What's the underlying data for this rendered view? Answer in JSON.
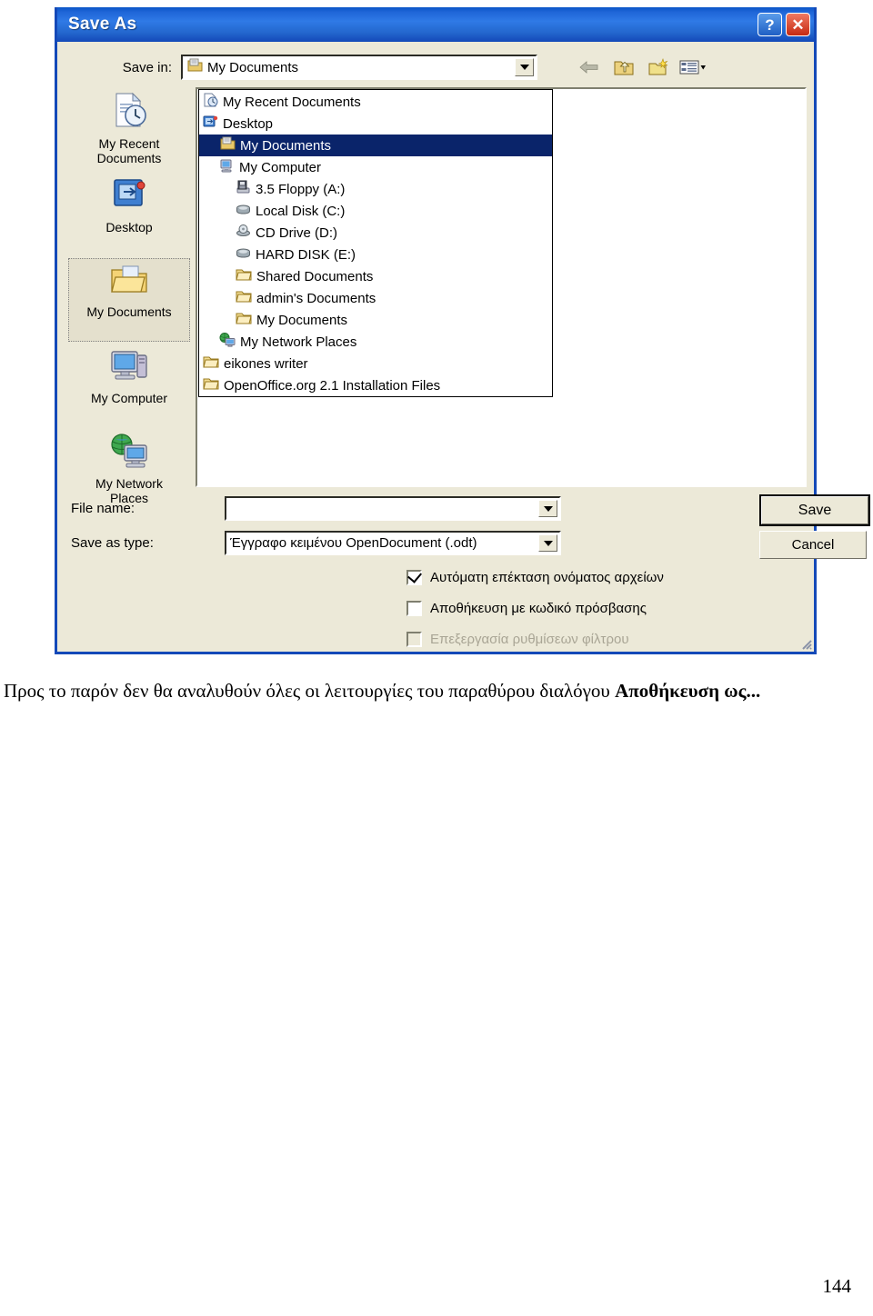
{
  "dialog": {
    "title": "Save As",
    "help_button": "?",
    "close_button": "✕",
    "save_in_label": "Save in:",
    "save_in_value": "My Documents",
    "file_name_label": "File name:",
    "file_name_value": "",
    "file_name_placeholder": "",
    "save_as_type_label": "Save as type:",
    "save_as_type_value": "Έγγραφο κειμένου OpenDocument (.odt)",
    "save_button": "Save",
    "cancel_button": "Cancel",
    "toolbar": [
      {
        "name": "back-icon",
        "tooltip": "Back"
      },
      {
        "name": "up-one-level-icon",
        "tooltip": "Up One Level"
      },
      {
        "name": "create-new-folder-icon",
        "tooltip": "Create New Folder"
      },
      {
        "name": "views-icon",
        "tooltip": "Views"
      }
    ],
    "places": [
      {
        "label": "My Recent\nDocuments",
        "icon": "recent-documents-icon",
        "selected": false
      },
      {
        "label": "Desktop",
        "icon": "desktop-icon",
        "selected": false
      },
      {
        "label": "My Documents",
        "icon": "my-documents-folder-icon",
        "selected": true
      },
      {
        "label": "My Computer",
        "icon": "my-computer-icon",
        "selected": false
      },
      {
        "label": "My Network\nPlaces",
        "icon": "my-network-places-icon",
        "selected": false
      }
    ],
    "dropdown_items": [
      {
        "label": "My Recent Documents",
        "icon": "recent-documents-icon",
        "indent": 0,
        "selected": false
      },
      {
        "label": "Desktop",
        "icon": "desktop-icon",
        "indent": 0,
        "selected": false
      },
      {
        "label": "My Documents",
        "icon": "my-documents-folder-icon",
        "indent": 1,
        "selected": true
      },
      {
        "label": "My Computer",
        "icon": "my-computer-icon",
        "indent": 1,
        "selected": false
      },
      {
        "label": "3.5 Floppy (A:)",
        "icon": "floppy-drive-icon",
        "indent": 2,
        "selected": false
      },
      {
        "label": "Local Disk (C:)",
        "icon": "hard-drive-icon",
        "indent": 2,
        "selected": false
      },
      {
        "label": "CD Drive (D:)",
        "icon": "cd-drive-icon",
        "indent": 2,
        "selected": false
      },
      {
        "label": "HARD DISK (E:)",
        "icon": "hard-drive-icon",
        "indent": 2,
        "selected": false
      },
      {
        "label": "Shared Documents",
        "icon": "folder-icon",
        "indent": 2,
        "selected": false
      },
      {
        "label": "admin's Documents",
        "icon": "folder-icon",
        "indent": 2,
        "selected": false
      },
      {
        "label": "My Documents",
        "icon": "folder-icon",
        "indent": 2,
        "selected": false
      },
      {
        "label": "My Network Places",
        "icon": "my-network-places-icon",
        "indent": 1,
        "selected": false
      },
      {
        "label": "eikones writer",
        "icon": "folder-icon",
        "indent": 0,
        "selected": false
      },
      {
        "label": "OpenOffice.org 2.1 Installation Files",
        "icon": "folder-icon",
        "indent": 0,
        "selected": false
      }
    ],
    "checkboxes": [
      {
        "label": "Αυτόματη επέκταση ονόματος αρχείων",
        "checked": true,
        "disabled": false
      },
      {
        "label": "Αποθήκευση με κωδικό πρόσβασης",
        "checked": false,
        "disabled": false
      },
      {
        "label": "Επεξεργασία ρυθμίσεων φίλτρου",
        "checked": false,
        "disabled": true
      }
    ]
  },
  "page": {
    "caption_before": "Προς το παρόν δεν θα αναλυθούν όλες οι λειτουργίες του παραθύρου διαλόγου ",
    "caption_bold": "Αποθήκευση ως...",
    "page_number": "144"
  },
  "colors": {
    "titlebar_blue": "#1f66d8",
    "dialog_face": "#ECE9D8",
    "selection_blue": "#0a246a",
    "close_red": "#c62a12",
    "disabled_text": "#a9a595"
  }
}
